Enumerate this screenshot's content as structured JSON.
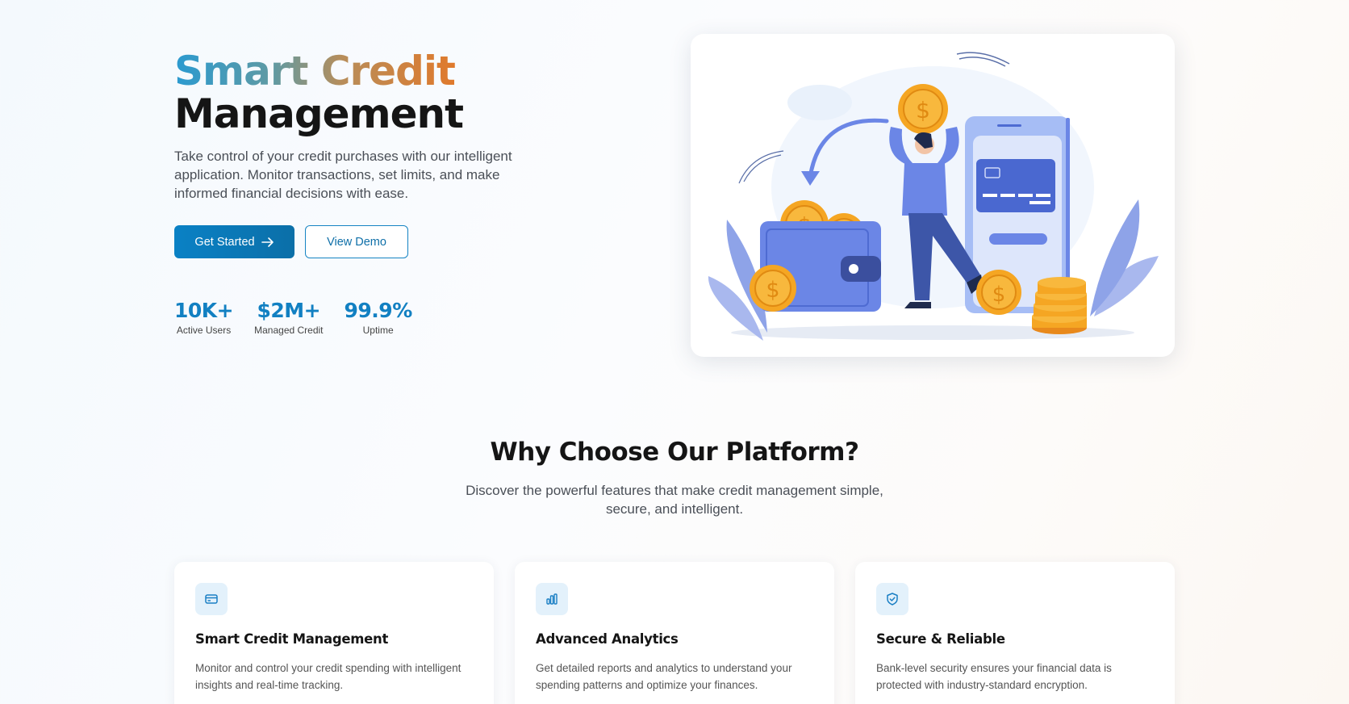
{
  "hero": {
    "title_part1": "Smart Credit",
    "title_part2": "Management",
    "description": "Take control of your credit purchases with our intelligent application. Monitor transactions, set limits, and make informed financial decisions with ease.",
    "primary_button": "Get Started",
    "secondary_button": "View Demo"
  },
  "stats": [
    {
      "value": "10K+",
      "label": "Active Users"
    },
    {
      "value": "$2M+",
      "label": "Managed Credit"
    },
    {
      "value": "99.9%",
      "label": "Uptime"
    }
  ],
  "illustration": {
    "icon": "wallet-phone-coins-illustration",
    "coin_symbol": "$"
  },
  "features": {
    "title": "Why Choose Our Platform?",
    "subtitle": "Discover the powerful features that make credit management simple, secure, and intelligent.",
    "cards": [
      {
        "icon": "credit-card-icon",
        "title": "Smart Credit Management",
        "description": "Monitor and control your credit spending with intelligent insights and real-time tracking."
      },
      {
        "icon": "bar-chart-icon",
        "title": "Advanced Analytics",
        "description": "Get detailed reports and analytics to understand your spending patterns and optimize your finances."
      },
      {
        "icon": "shield-check-icon",
        "title": "Secure & Reliable",
        "description": "Bank-level security ensures your financial data is protected with industry-standard encryption."
      }
    ]
  },
  "colors": {
    "primary": "#0a81c5",
    "accent_orange": "#e07a2c",
    "illustration_blue": "#6b86e6",
    "coin": "#f5a623"
  }
}
